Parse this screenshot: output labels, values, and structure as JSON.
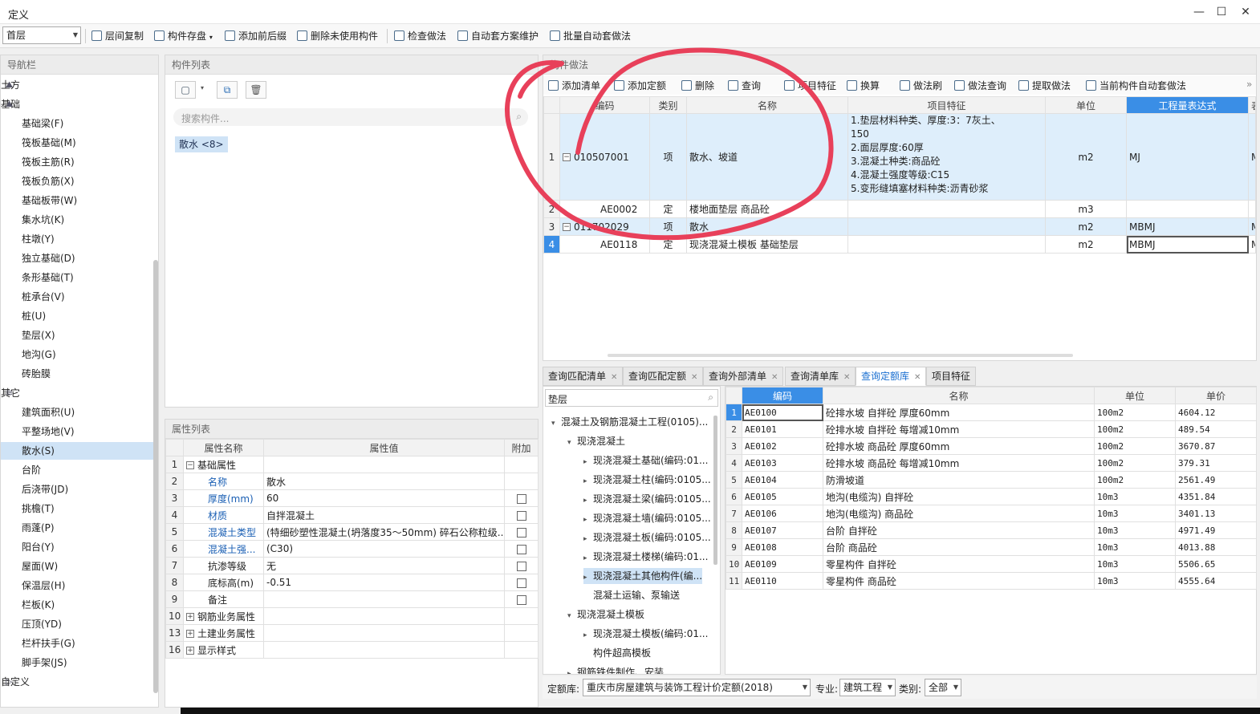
{
  "window": {
    "title": "定义"
  },
  "toolbar": {
    "floor": "首层",
    "buttons": [
      "层间复制",
      "构件存盘",
      "添加前后缀",
      "删除未使用构件",
      "检查做法",
      "自动套方案维护",
      "批量自动套做法"
    ]
  },
  "nav": {
    "title": "导航栏",
    "items": [
      {
        "label": "土方",
        "type": "group",
        "icon": "earth-icon"
      },
      {
        "label": "基础",
        "type": "group",
        "icon": "foundation-icon"
      },
      {
        "label": "基础梁(F)",
        "type": "sub"
      },
      {
        "label": "筏板基础(M)",
        "type": "sub"
      },
      {
        "label": "筏板主筋(R)",
        "type": "sub"
      },
      {
        "label": "筏板负筋(X)",
        "type": "sub"
      },
      {
        "label": "基础板带(W)",
        "type": "sub"
      },
      {
        "label": "集水坑(K)",
        "type": "sub"
      },
      {
        "label": "柱墩(Y)",
        "type": "sub"
      },
      {
        "label": "独立基础(D)",
        "type": "sub"
      },
      {
        "label": "条形基础(T)",
        "type": "sub"
      },
      {
        "label": "桩承台(V)",
        "type": "sub"
      },
      {
        "label": "桩(U)",
        "type": "sub"
      },
      {
        "label": "垫层(X)",
        "type": "sub"
      },
      {
        "label": "地沟(G)",
        "type": "sub"
      },
      {
        "label": "砖胎膜",
        "type": "sub"
      },
      {
        "label": "其它",
        "type": "group",
        "icon": "layers-icon"
      },
      {
        "label": "建筑面积(U)",
        "type": "sub"
      },
      {
        "label": "平整场地(V)",
        "type": "sub"
      },
      {
        "label": "散水(S)",
        "type": "sub",
        "selected": true
      },
      {
        "label": "台阶",
        "type": "sub"
      },
      {
        "label": "后浇带(JD)",
        "type": "sub"
      },
      {
        "label": "挑檐(T)",
        "type": "sub"
      },
      {
        "label": "雨蓬(P)",
        "type": "sub"
      },
      {
        "label": "阳台(Y)",
        "type": "sub"
      },
      {
        "label": "屋面(W)",
        "type": "sub"
      },
      {
        "label": "保温层(H)",
        "type": "sub"
      },
      {
        "label": "栏板(K)",
        "type": "sub"
      },
      {
        "label": "压顶(YD)",
        "type": "sub"
      },
      {
        "label": "栏杆扶手(G)",
        "type": "sub"
      },
      {
        "label": "脚手架(JS)",
        "type": "sub"
      },
      {
        "label": "自定义",
        "type": "group",
        "icon": "custom-icon"
      }
    ]
  },
  "components": {
    "title": "构件列表",
    "search_placeholder": "搜索构件...",
    "items": [
      "散水 <8>"
    ]
  },
  "properties": {
    "title": "属性列表",
    "headers": [
      "属性名称",
      "属性值",
      "附加"
    ],
    "rows": [
      {
        "n": "1",
        "name": "基础属性",
        "value": "",
        "check": false,
        "expand": "-",
        "group": true,
        "link": false
      },
      {
        "n": "2",
        "name": "名称",
        "value": "散水",
        "check": false,
        "link": true,
        "nocheck": true
      },
      {
        "n": "3",
        "name": "厚度(mm)",
        "value": "60",
        "check": true,
        "link": true
      },
      {
        "n": "4",
        "name": "材质",
        "value": "自拌混凝土",
        "check": true,
        "link": true
      },
      {
        "n": "5",
        "name": "混凝土类型",
        "value": "(特细砂塑性混凝土(坍落度35～50mm) 碎石公称粒级...",
        "check": true,
        "link": true
      },
      {
        "n": "6",
        "name": "混凝土强...",
        "value": "(C30)",
        "check": true,
        "link": true
      },
      {
        "n": "7",
        "name": "抗渗等级",
        "value": "无",
        "check": true,
        "link": false
      },
      {
        "n": "8",
        "name": "底标高(m)",
        "value": "-0.51",
        "check": true,
        "link": false
      },
      {
        "n": "9",
        "name": "备注",
        "value": "",
        "check": true,
        "link": false
      },
      {
        "n": "10",
        "name": "钢筋业务属性",
        "value": "",
        "expand": "+",
        "group": true
      },
      {
        "n": "13",
        "name": "土建业务属性",
        "value": "",
        "expand": "+",
        "group": true
      },
      {
        "n": "16",
        "name": "显示样式",
        "value": "",
        "expand": "+",
        "group": true
      }
    ]
  },
  "method": {
    "title": "构件做法",
    "toolbar": [
      "添加清单",
      "添加定额",
      "删除",
      "查询",
      "项目特征",
      "换算",
      "做法刷",
      "做法查询",
      "提取做法",
      "当前构件自动套做法"
    ],
    "headers": [
      "编码",
      "类别",
      "名称",
      "项目特征",
      "单位",
      "工程量表达式",
      "表达式说明"
    ],
    "rows": [
      {
        "n": "1",
        "code": "010507001",
        "type": "项",
        "name": "散水、坡道",
        "feature": [
          "1.垫层材料种类、厚度:3：7灰土、",
          "150",
          "2.面层厚度:60厚",
          "3.混凝土种类:商品砼",
          "4.混凝土强度等级:C15",
          "5.变形缝填塞材料种类:沥青砂浆"
        ],
        "unit": "m2",
        "expr": "MJ",
        "desc": "MJ<面积>",
        "hl": true,
        "expand": "-"
      },
      {
        "n": "2",
        "code": "AE0002",
        "type": "定",
        "name": "楼地面垫层 商品砼",
        "feature": [],
        "unit": "m3",
        "expr": "",
        "desc": ""
      },
      {
        "n": "3",
        "code": "011702029",
        "type": "项",
        "name": "散水",
        "feature": [],
        "unit": "m2",
        "expr": "MBMJ",
        "desc": "MBMJ<模板面积>",
        "hl": true,
        "expand": "-"
      },
      {
        "n": "4",
        "code": "AE0118",
        "type": "定",
        "name": "现浇混凝土模板 基础垫层",
        "feature": [],
        "unit": "m2",
        "expr": "MBMJ",
        "desc": "MBMJ<模板面积>",
        "cur": true
      }
    ]
  },
  "tabs": [
    {
      "label": "查询匹配清单"
    },
    {
      "label": "查询匹配定额"
    },
    {
      "label": "查询外部清单"
    },
    {
      "label": "查询清单库"
    },
    {
      "label": "查询定额库",
      "active": true
    },
    {
      "label": "项目特征",
      "noclose": true
    }
  ],
  "tree": {
    "search": "垫层",
    "nodes": [
      {
        "label": "混凝土及钢筋混凝土工程(0105)...",
        "indent": 0,
        "arrow": "▾"
      },
      {
        "label": "现浇混凝土",
        "indent": 1,
        "arrow": "▾"
      },
      {
        "label": "现浇混凝土基础(编码:01...",
        "indent": 2,
        "arrow": "▸"
      },
      {
        "label": "现浇混凝土柱(编码:0105...",
        "indent": 2,
        "arrow": "▸"
      },
      {
        "label": "现浇混凝土梁(编码:0105...",
        "indent": 2,
        "arrow": "▸"
      },
      {
        "label": "现浇混凝土墙(编码:0105...",
        "indent": 2,
        "arrow": "▸"
      },
      {
        "label": "现浇混凝土板(编码:0105...",
        "indent": 2,
        "arrow": "▸"
      },
      {
        "label": "现浇混凝土楼梯(编码:01...",
        "indent": 2,
        "arrow": "▸"
      },
      {
        "label": "现浇混凝土其他构件(编...",
        "indent": 2,
        "arrow": "▸",
        "selected": true
      },
      {
        "label": "混凝土运输、泵输送",
        "indent": 2,
        "arrow": ""
      },
      {
        "label": "现浇混凝土模板",
        "indent": 1,
        "arrow": "▾"
      },
      {
        "label": "现浇混凝土模板(编码:01...",
        "indent": 2,
        "arrow": "▸"
      },
      {
        "label": "构件超高模板",
        "indent": 2,
        "arrow": ""
      },
      {
        "label": "钢筋铁件制作、安装",
        "indent": 1,
        "arrow": "▸"
      }
    ]
  },
  "quota": {
    "headers": [
      "编码",
      "名称",
      "单位",
      "单价"
    ],
    "rows": [
      {
        "n": "1",
        "code": "AE0100",
        "name": "砼排水坡 自拌砼 厚度60mm",
        "unit": "100m2",
        "price": "4604.12"
      },
      {
        "n": "2",
        "code": "AE0101",
        "name": "砼排水坡 自拌砼 每增减10mm",
        "unit": "100m2",
        "price": "489.54"
      },
      {
        "n": "3",
        "code": "AE0102",
        "name": "砼排水坡 商品砼 厚度60mm",
        "unit": "100m2",
        "price": "3670.87"
      },
      {
        "n": "4",
        "code": "AE0103",
        "name": "砼排水坡 商品砼 每增减10mm",
        "unit": "100m2",
        "price": "379.31"
      },
      {
        "n": "5",
        "code": "AE0104",
        "name": "防滑坡道",
        "unit": "100m2",
        "price": "2561.49"
      },
      {
        "n": "6",
        "code": "AE0105",
        "name": "地沟(电缆沟) 自拌砼",
        "unit": "10m3",
        "price": "4351.84"
      },
      {
        "n": "7",
        "code": "AE0106",
        "name": "地沟(电缆沟) 商品砼",
        "unit": "10m3",
        "price": "3401.13"
      },
      {
        "n": "8",
        "code": "AE0107",
        "name": "台阶 自拌砼",
        "unit": "10m3",
        "price": "4971.49"
      },
      {
        "n": "9",
        "code": "AE0108",
        "name": "台阶 商品砼",
        "unit": "10m3",
        "price": "4013.88"
      },
      {
        "n": "10",
        "code": "AE0109",
        "name": "零星构件 自拌砼",
        "unit": "10m3",
        "price": "5506.65"
      },
      {
        "n": "11",
        "code": "AE0110",
        "name": "零星构件 商品砼",
        "unit": "10m3",
        "price": "4555.64"
      }
    ]
  },
  "bottom": {
    "lib_label": "定额库:",
    "lib_value": "重庆市房屋建筑与装饰工程计价定额(2018)",
    "spec_label": "专业:",
    "spec_value": "建筑工程",
    "cat_label": "类别:",
    "cat_value": "全部"
  },
  "colors": {
    "selection": "#cfe3f6",
    "highlight_row": "#deeefb",
    "active_header": "#3a8ee6",
    "annotation": "#e8405a"
  }
}
